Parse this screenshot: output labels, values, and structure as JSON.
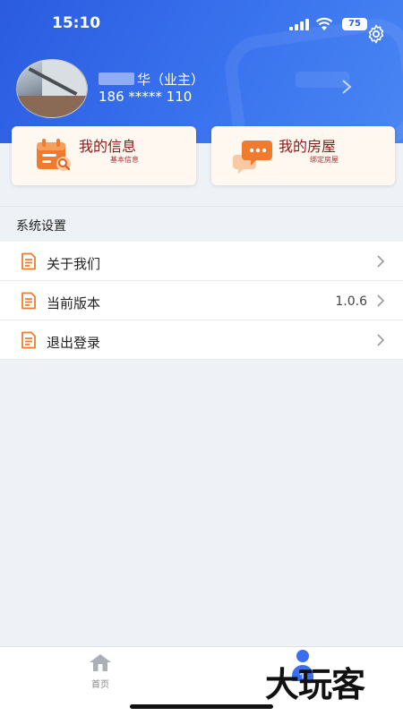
{
  "status_bar": {
    "time": "15:10",
    "battery": "75"
  },
  "profile": {
    "name_suffix": "华（业主）",
    "phone": "186 ***** 110"
  },
  "cards": [
    {
      "title": "我的信息",
      "subtitle": "基本信息"
    },
    {
      "title": "我的房屋",
      "subtitle": "绑定房屋"
    }
  ],
  "section": {
    "title": "系统设置"
  },
  "menu": [
    {
      "label": "关于我们",
      "value": ""
    },
    {
      "label": "当前版本",
      "value": "1.0.6"
    },
    {
      "label": "退出登录",
      "value": ""
    }
  ],
  "tabbar": {
    "home_label": "首页"
  },
  "watermark": "大玩客",
  "colors": {
    "header_blue": "#2a5be0",
    "card_bg": "#fff8f0",
    "icon_orange": "#f07a2e",
    "title_red": "#8a1a1a"
  },
  "icons": [
    "signal-icon",
    "wifi-icon",
    "battery-icon",
    "gear-icon",
    "chevron-right-icon",
    "calendar-icon",
    "chat-icon",
    "document-icon",
    "home-icon",
    "profile-icon"
  ]
}
